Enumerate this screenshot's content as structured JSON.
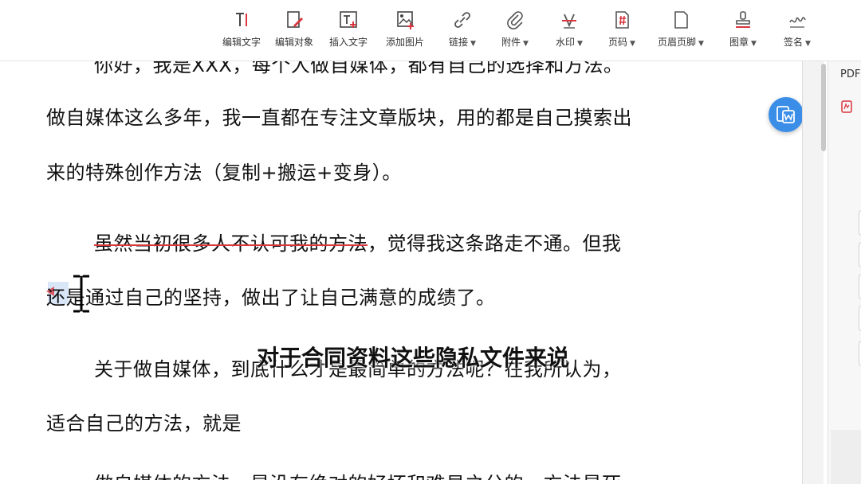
{
  "toolbar": {
    "items": [
      {
        "label": "编辑文字",
        "icon": "edit-text-icon"
      },
      {
        "label": "编辑对象",
        "icon": "edit-object-icon"
      },
      {
        "label": "插入文字",
        "icon": "insert-text-icon"
      },
      {
        "label": "添加图片",
        "icon": "add-image-icon"
      },
      {
        "label": "链接",
        "icon": "link-icon"
      },
      {
        "label": "附件",
        "icon": "attachment-icon"
      },
      {
        "label": "水印",
        "icon": "watermark-icon"
      },
      {
        "label": "页码",
        "icon": "page-number-icon"
      },
      {
        "label": "页眉页脚",
        "icon": "header-footer-icon"
      },
      {
        "label": "图章",
        "icon": "stamp-icon"
      },
      {
        "label": "签名",
        "icon": "signature-icon"
      }
    ]
  },
  "document": {
    "line_top_clipped": "你好，我是XXX，每个人做自媒体，都有自己的选择和方法。",
    "p1_line1": "做自媒体这么多年，我一直都在专注文章版块，用的都是自己摸索出",
    "p1_line2": "来的特殊创作方法（复制+搬运+变身）。",
    "p2_struck": "虽然当初很多人不认可我的方法",
    "p2_rest": "，觉得我这条路走不通。但我",
    "p2_line2": "还是通过自己的坚持，做出了让自己满意的成绩了。",
    "p3_line1": "关于做自媒体，到底什么才是最简单的方法呢？在我所认为，",
    "p3_line2": "适合自己的方法，就是",
    "line_bottom_clipped": "做自媒体的方法，是没有绝对的好坏和难易之分的，方法是死"
  },
  "subtitle": "对于合同资料这些隐私文件来说",
  "side_panel": {
    "label": "PDF"
  },
  "colors": {
    "accent": "#3b8ee8",
    "strike": "#d9363e",
    "stamp": "#d9363e"
  }
}
